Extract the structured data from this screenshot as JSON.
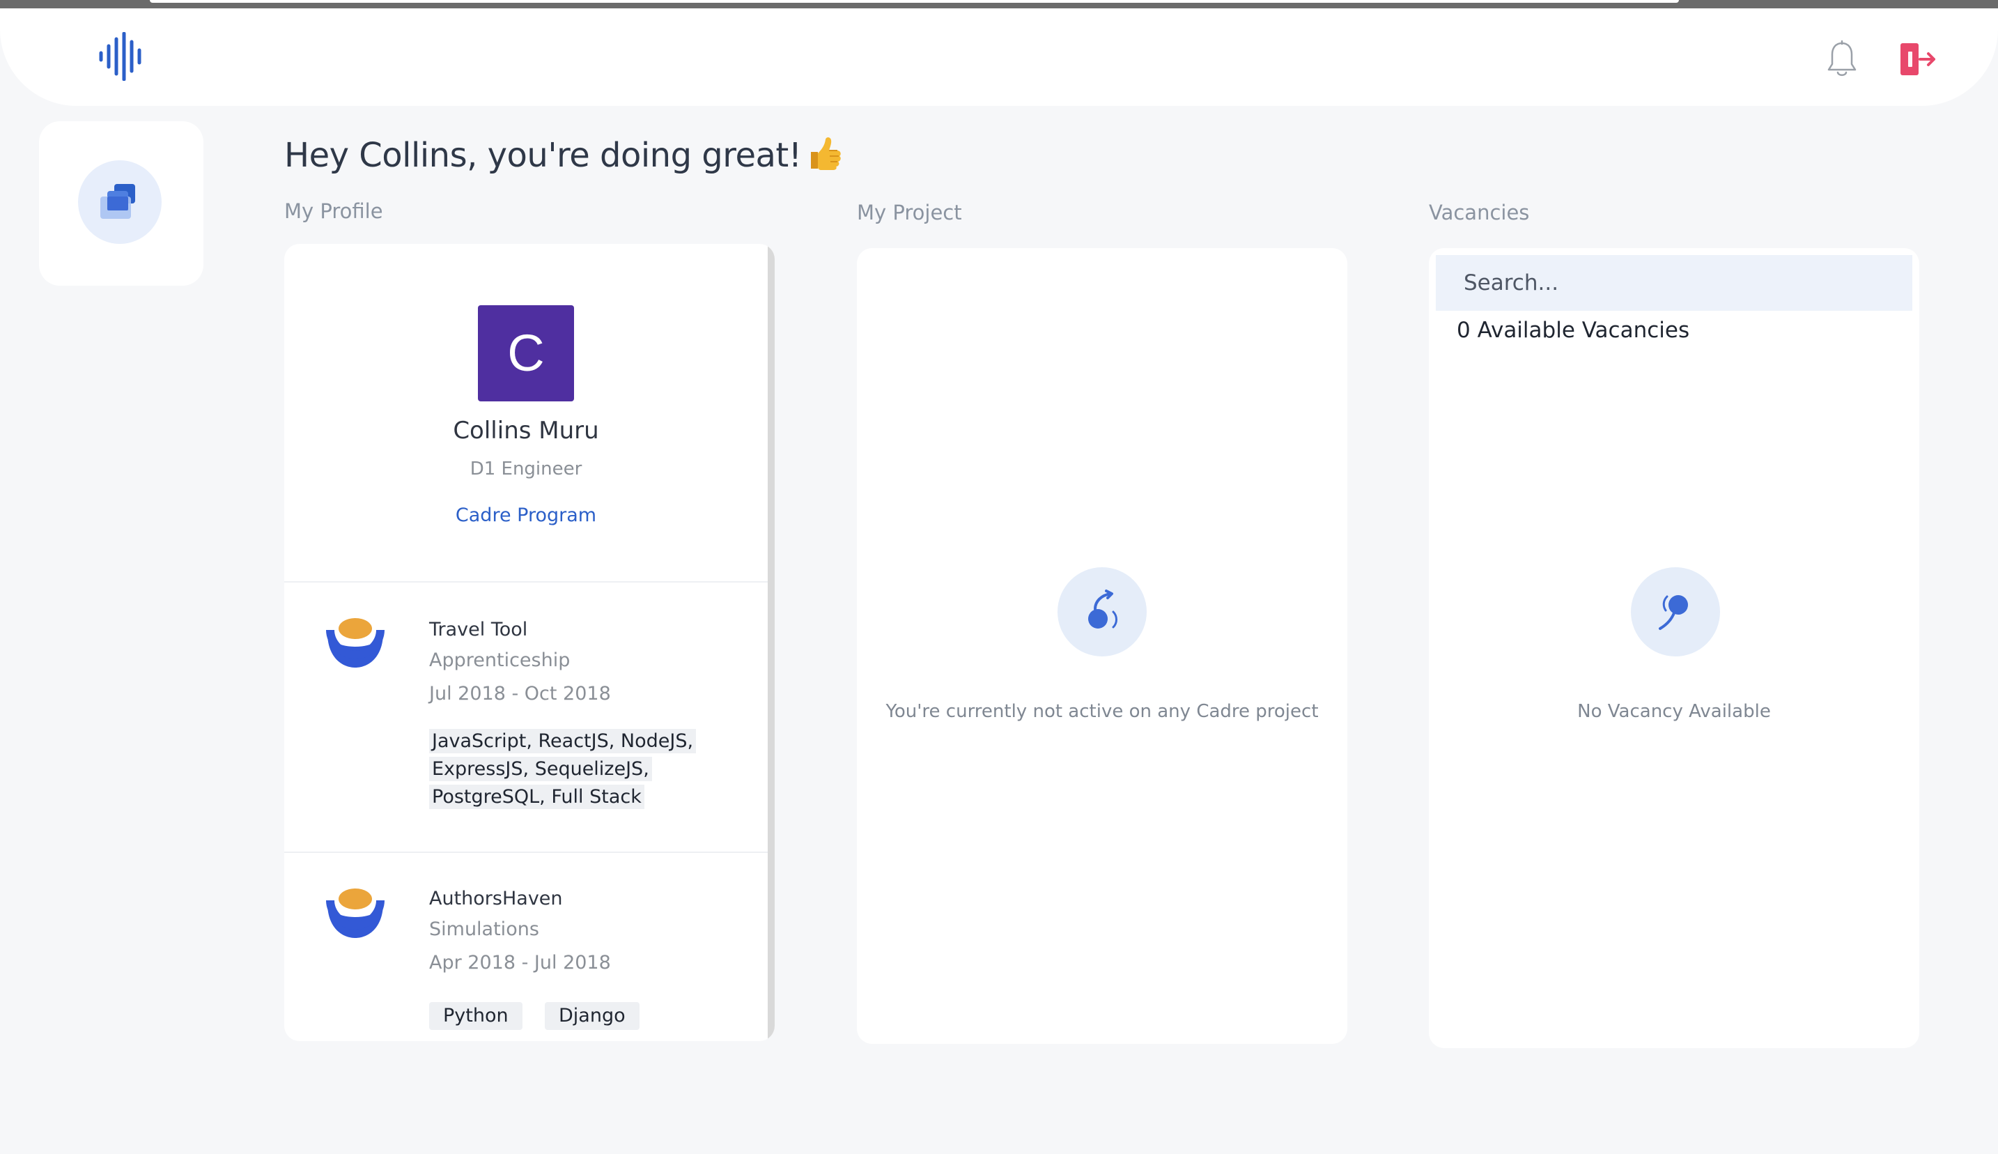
{
  "header": {
    "logo_icon": "sound-wave-logo-icon",
    "notification_icon": "bell-icon",
    "logout_icon": "logout-icon",
    "accent": "#2b5fc8",
    "logout_color": "#e8486b"
  },
  "sidebar": {
    "items": [
      {
        "icon": "layers-icon",
        "active": true
      }
    ]
  },
  "greeting": {
    "text": "Hey Collins, you're doing great!",
    "emoji_icon": "thumbs-up-icon"
  },
  "sections": {
    "profile_label": "My Profile",
    "project_label": "My Project",
    "vacancies_label": "Vacancies"
  },
  "profile": {
    "avatar_letter": "C",
    "avatar_color": "#4f2fa0",
    "name": "Collins Muru",
    "role": "D1 Engineer",
    "program": "Cadre Program",
    "experiences": [
      {
        "title": "Travel Tool",
        "type": "Apprenticeship",
        "dates": "Jul 2018 - Oct 2018",
        "skills": "JavaScript, ReactJS, NodeJS, ExpressJS, SequelizeJS, PostgreSQL, Full Stack"
      },
      {
        "title": "AuthorsHaven",
        "type": "Simulations",
        "dates": "Apr 2018 - Jul 2018",
        "skills": [
          "Python",
          "Django"
        ]
      }
    ]
  },
  "project": {
    "empty_icon": "no-project-icon",
    "empty_message": "You're currently not active on any Cadre project"
  },
  "vacancies": {
    "search_placeholder": "Search...",
    "count_text": "0 Available Vacancies",
    "empty_icon": "no-vacancy-icon",
    "empty_message": "No Vacancy Available"
  }
}
